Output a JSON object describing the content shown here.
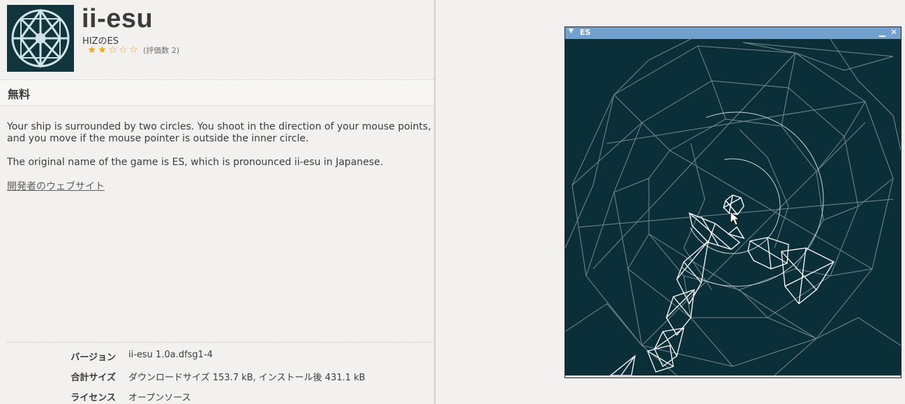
{
  "app": {
    "title": "ii-esu",
    "publisher": "HIZのES",
    "rating_stars": [
      "★",
      "★",
      "☆",
      "☆",
      "☆"
    ],
    "rating_count": "(評価数 2)",
    "icon": "es-wheel-icon"
  },
  "price": "無料",
  "description": [
    "Your ship is surrounded by two circles. You shoot in the direction of your mouse points, and you move if the mouse pointer is outside the inner circle.",
    "The original name of the game is ES, which is pronounced ii-esu in Japanese."
  ],
  "developer_link": "開発者のウェブサイト",
  "details": [
    {
      "key": "バージョン",
      "value": "ii-esu 1.0a.dfsg1-4"
    },
    {
      "key": "合計サイズ",
      "value": "ダウンロードサイズ 153.7 kB, インストール後 431.1 kB"
    },
    {
      "key": "ライセンス",
      "value": "オープンソース"
    }
  ],
  "game_window": {
    "title": "ES",
    "menu_icon": "triangle-down-icon",
    "minimize_icon": "minimize-icon",
    "close_icon": "close-icon",
    "minimize_glyph": "▁",
    "close_glyph": "✕"
  },
  "colors": {
    "game_background": "#0a2f38",
    "titlebar": "#72a0cf",
    "stars": "#f0a30a",
    "wireframe": "#8a9a9c",
    "ship": "#ffffff"
  }
}
